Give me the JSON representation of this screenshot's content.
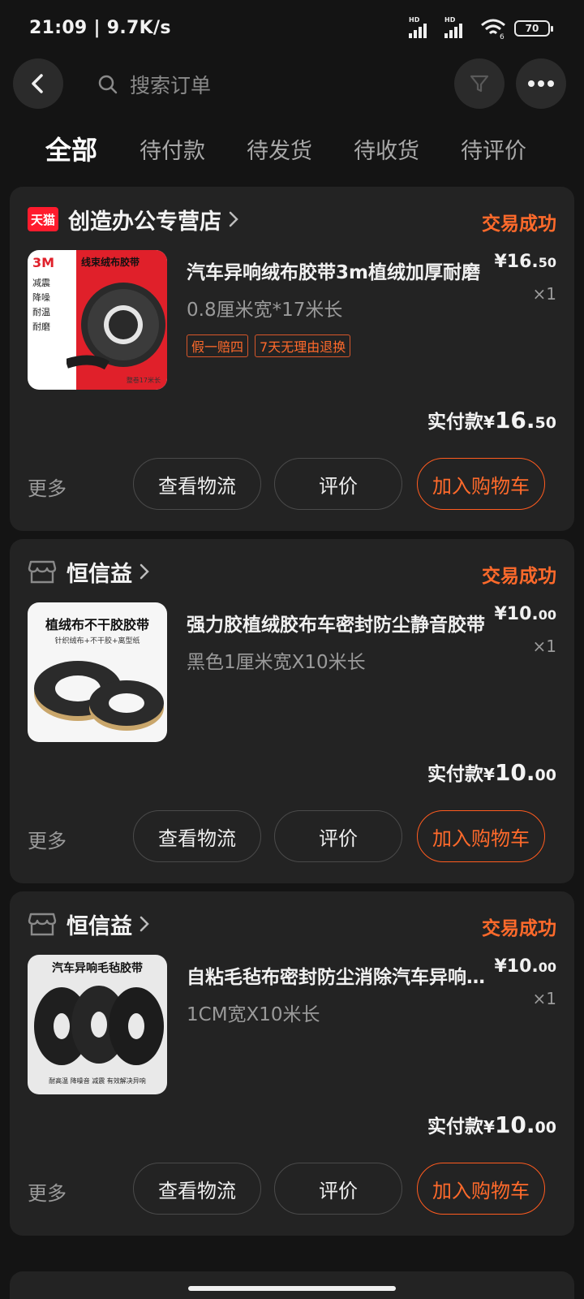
{
  "status_bar": {
    "time": "21:09 | 9.7K/s",
    "signal_label": "HD",
    "wifi_sub": "6",
    "battery": "70"
  },
  "header": {
    "search_placeholder": "搜索订单"
  },
  "tabs": [
    {
      "label": "全部",
      "active": true
    },
    {
      "label": "待付款"
    },
    {
      "label": "待发货"
    },
    {
      "label": "待收货"
    },
    {
      "label": "待评价"
    }
  ],
  "orders": [
    {
      "store_badge": "天猫",
      "store": "创造办公专营店",
      "status": "交易成功",
      "title": "汽车异响绒布胶带3m植绒加厚耐磨",
      "spec": "0.8厘米宽*17米长",
      "tags": [
        "假一赔四",
        "7天无理由退换"
      ],
      "price_int": "¥16.",
      "price_dec": "50",
      "qty": "×1",
      "paid_label": "实付款",
      "paid_cur": "¥",
      "paid_int": "16.",
      "paid_dec": "50",
      "image": {
        "brand": "3M",
        "banner": "线束绒布胶带",
        "list": [
          "减震",
          "降噪",
          "耐温",
          "耐磨"
        ],
        "foot": "整卷17米长"
      }
    },
    {
      "store": "恒信益",
      "status": "交易成功",
      "title": "强力胶植绒胶布车密封防尘静音胶带",
      "spec": "黑色1厘米宽X10米长",
      "price_int": "¥10.",
      "price_dec": "00",
      "qty": "×1",
      "paid_label": "实付款",
      "paid_cur": "¥",
      "paid_int": "10.",
      "paid_dec": "00",
      "image": {
        "title": "植绒布不干胶胶带",
        "sub": "针织绒布+不干胶+离型纸"
      }
    },
    {
      "store": "恒信益",
      "status": "交易成功",
      "title": "自粘毛毡布密封防尘消除汽车异响胶带",
      "spec": "1CM宽X10米长",
      "price_int": "¥10.",
      "price_dec": "00",
      "qty": "×1",
      "paid_label": "实付款",
      "paid_cur": "¥",
      "paid_int": "10.",
      "paid_dec": "00",
      "image": {
        "title": "汽车异响毛毡胶带",
        "sub": "耐高温  降噪音  减震  有效解决异响"
      }
    }
  ],
  "actions": {
    "more": "更多",
    "logistics": "查看物流",
    "review": "评价",
    "cart": "加入购物车"
  },
  "colors": {
    "accent": "#ff6a2b",
    "card": "#232323",
    "background": "#141414",
    "tmall_red": "#ff1b2d"
  }
}
